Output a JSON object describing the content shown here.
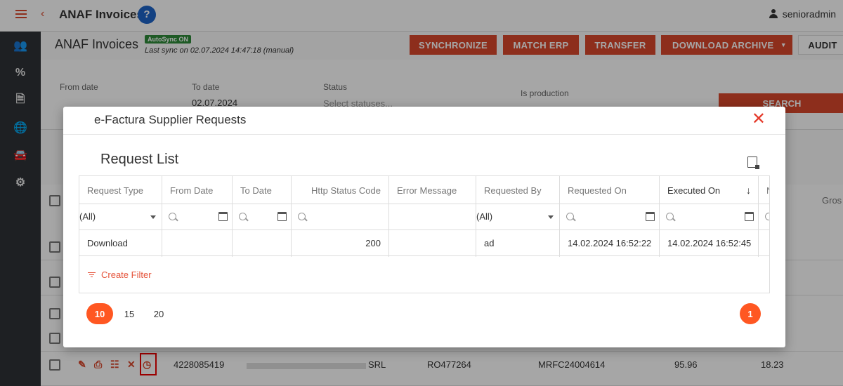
{
  "app": {
    "title": "ANAF Invoices",
    "help_icon": "?",
    "user": "senioradmin"
  },
  "sidebar": {
    "items": [
      {
        "icon": "users-icon",
        "glyph": "👥"
      },
      {
        "icon": "percent-icon",
        "glyph": "%"
      },
      {
        "icon": "document-icon",
        "glyph": "🗎"
      },
      {
        "icon": "globe-icon",
        "glyph": "🌐"
      },
      {
        "icon": "car-icon",
        "glyph": "🚘"
      },
      {
        "icon": "gear-icon",
        "glyph": "⚙"
      }
    ]
  },
  "page": {
    "title": "ANAF Invoices",
    "autosync": "AutoSync ON",
    "last_sync": "Last sync on 02.07.2024 14:47:18 (manual)",
    "buttons": {
      "synchronize": "SYNCHRONIZE",
      "match_erp": "MATCH ERP",
      "transfer": "TRANSFER",
      "download_archive": "DOWNLOAD ARCHIVE",
      "audit": "AUDIT"
    },
    "filters": {
      "from_date_label": "From date",
      "to_date_label": "To date",
      "to_date_value": "02.07.2024",
      "status_label": "Status",
      "status_placeholder": "Select statuses...",
      "is_production_label": "Is production",
      "search": "SEARCH"
    },
    "grid": {
      "partial_header": "Gros",
      "row": {
        "number": "4228085419",
        "name_suffix": "SRL",
        "vat": "RO477264",
        "erp_ref": "MRFC24004614",
        "amount": "95.96",
        "vat_amount": "18.23"
      }
    }
  },
  "modal": {
    "title": "e-Factura Supplier Requests",
    "list_title": "Request List",
    "columns": [
      {
        "label": "Request Type"
      },
      {
        "label": "From Date"
      },
      {
        "label": "To Date"
      },
      {
        "label": "Http Status Code"
      },
      {
        "label": "Error Message"
      },
      {
        "label": "Requested By"
      },
      {
        "label": "Requested On"
      },
      {
        "label": "Executed On"
      },
      {
        "label": "N"
      }
    ],
    "filter_row": {
      "request_type": "(All)",
      "requested_by": "(All)"
    },
    "rows": [
      {
        "request_type": "Download",
        "from_date": "",
        "to_date": "",
        "http_status": "200",
        "error": "",
        "requested_by": "ad",
        "requested_on": "14.02.2024 16:52:22",
        "executed_on": "14.02.2024 16:52:45"
      }
    ],
    "create_filter": "Create Filter",
    "page_sizes": [
      "10",
      "15",
      "20"
    ],
    "active_page_size": "10",
    "current_page": "1"
  }
}
